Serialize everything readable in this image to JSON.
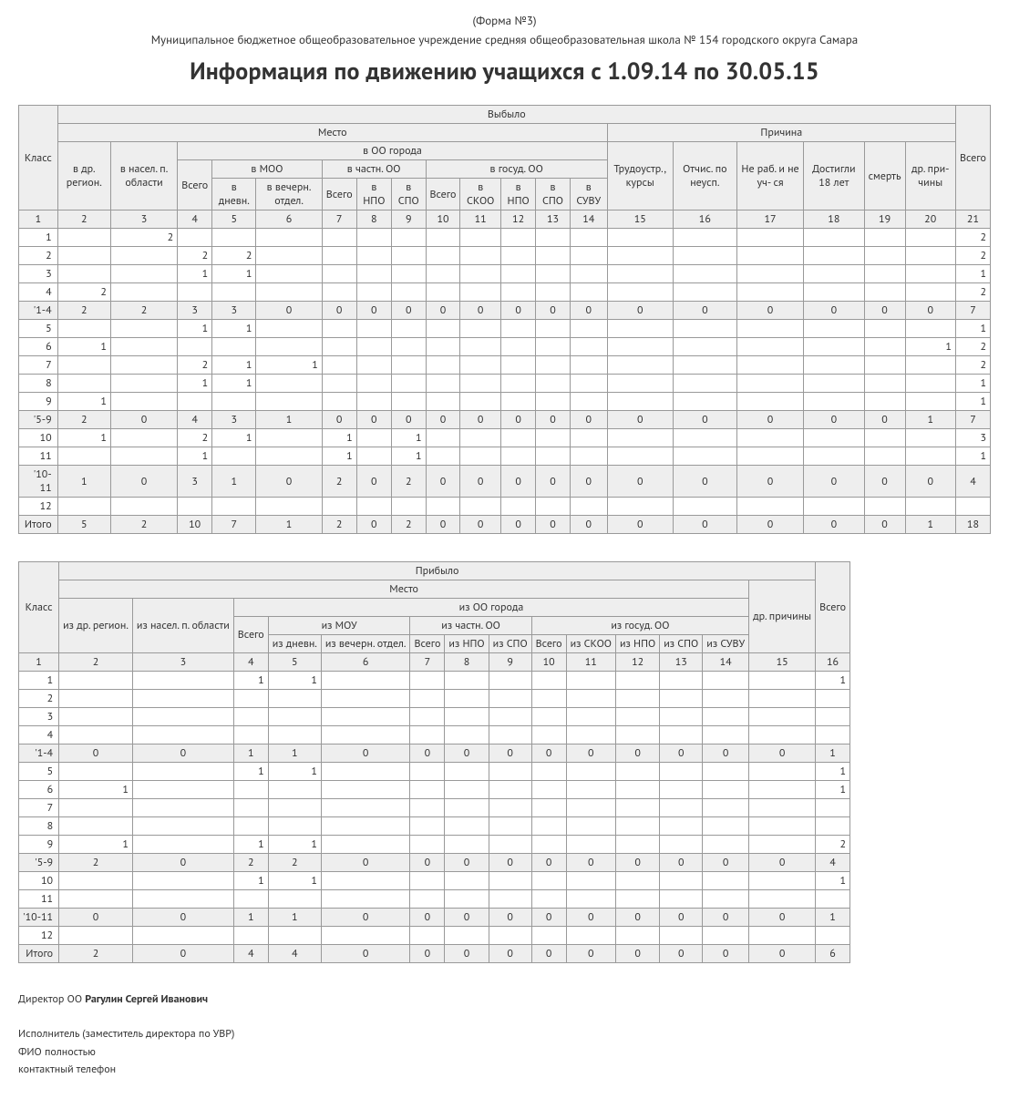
{
  "header": {
    "form_no": "(Форма №3)",
    "org": "Муниципальное бюджетное общеобразовательное учреждение средняя общеобразовательная школа № 154 городского округа Самара",
    "title": "Информация по движению учащихся с 1.09.14 по 30.05.15"
  },
  "table1": {
    "caption_top": "Выбыло",
    "caption_place": "Место",
    "caption_reason": "Причина",
    "caption_city": "в ОО города",
    "h": {
      "klass": "Класс",
      "region": "в др. реги­он.",
      "selo": "в на­сел. п. обл­асти",
      "vsego_moo": "Всего",
      "moo": "в МОО",
      "dnevn": "в дневн.",
      "vecher": "в вечерн. отдел.",
      "chast": "в частн. ОО",
      "vsego_ch": "Всего",
      "npo_ch": "в НПО",
      "spo_ch": "в СПО",
      "gos": "в госуд. ОО",
      "vsego_g": "Всего",
      "skoo": "в СКОО",
      "npo_g": "в НПО",
      "spo_g": "в СПО",
      "suvu": "в СУВУ",
      "trud": "Тру­до­устр., кур­сы",
      "otch": "От­чис. по неусп.",
      "nerab": "Не раб. и не уч- ся",
      "dost18": "Дос­тиг­ли 18 лет",
      "smert": "смерть",
      "dr": "др. при­чи­ны",
      "vsego": "Всего"
    },
    "colnums": [
      "1",
      "2",
      "3",
      "4",
      "5",
      "6",
      "7",
      "8",
      "9",
      "10",
      "11",
      "12",
      "13",
      "14",
      "15",
      "16",
      "17",
      "18",
      "19",
      "20",
      "21"
    ],
    "rows": [
      {
        "k": "1",
        "c": [
          "",
          "2",
          "",
          "",
          "",
          "",
          "",
          "",
          "",
          "",
          "",
          "",
          "",
          "",
          "",
          "",
          "",
          "",
          "",
          "2"
        ]
      },
      {
        "k": "2",
        "c": [
          "",
          "",
          "2",
          "2",
          "",
          "",
          "",
          "",
          "",
          "",
          "",
          "",
          "",
          "",
          "",
          "",
          "",
          "",
          "",
          "2"
        ]
      },
      {
        "k": "3",
        "c": [
          "",
          "",
          "1",
          "1",
          "",
          "",
          "",
          "",
          "",
          "",
          "",
          "",
          "",
          "",
          "",
          "",
          "",
          "",
          "",
          "1"
        ]
      },
      {
        "k": "4",
        "c": [
          "2",
          "",
          "",
          "",
          "",
          "",
          "",
          "",
          "",
          "",
          "",
          "",
          "",
          "",
          "",
          "",
          "",
          "",
          "",
          "2"
        ]
      },
      {
        "k": "'1-4",
        "sub": true,
        "c": [
          "2",
          "2",
          "3",
          "3",
          "0",
          "0",
          "0",
          "0",
          "0",
          "0",
          "0",
          "0",
          "0",
          "0",
          "0",
          "0",
          "0",
          "0",
          "0",
          "7"
        ]
      },
      {
        "k": "5",
        "c": [
          "",
          "",
          "1",
          "1",
          "",
          "",
          "",
          "",
          "",
          "",
          "",
          "",
          "",
          "",
          "",
          "",
          "",
          "",
          "",
          "1"
        ]
      },
      {
        "k": "6",
        "c": [
          "1",
          "",
          "",
          "",
          "",
          "",
          "",
          "",
          "",
          "",
          "",
          "",
          "",
          "",
          "",
          "",
          "",
          "",
          "1",
          "2"
        ]
      },
      {
        "k": "7",
        "c": [
          "",
          "",
          "2",
          "1",
          "1",
          "",
          "",
          "",
          "",
          "",
          "",
          "",
          "",
          "",
          "",
          "",
          "",
          "",
          "",
          "2"
        ]
      },
      {
        "k": "8",
        "c": [
          "",
          "",
          "1",
          "1",
          "",
          "",
          "",
          "",
          "",
          "",
          "",
          "",
          "",
          "",
          "",
          "",
          "",
          "",
          "",
          "1"
        ]
      },
      {
        "k": "9",
        "c": [
          "1",
          "",
          "",
          "",
          "",
          "",
          "",
          "",
          "",
          "",
          "",
          "",
          "",
          "",
          "",
          "",
          "",
          "",
          "",
          "1"
        ]
      },
      {
        "k": "'5-9",
        "sub": true,
        "c": [
          "2",
          "0",
          "4",
          "3",
          "1",
          "0",
          "0",
          "0",
          "0",
          "0",
          "0",
          "0",
          "0",
          "0",
          "0",
          "0",
          "0",
          "0",
          "1",
          "7"
        ]
      },
      {
        "k": "10",
        "c": [
          "1",
          "",
          "2",
          "1",
          "",
          "1",
          "",
          "1",
          "",
          "",
          "",
          "",
          "",
          "",
          "",
          "",
          "",
          "",
          "",
          "3"
        ]
      },
      {
        "k": "11",
        "c": [
          "",
          "",
          "1",
          "",
          "",
          "1",
          "",
          "1",
          "",
          "",
          "",
          "",
          "",
          "",
          "",
          "",
          "",
          "",
          "",
          "1"
        ]
      },
      {
        "k": "'10-11",
        "sub": true,
        "c": [
          "1",
          "0",
          "3",
          "1",
          "0",
          "2",
          "0",
          "2",
          "0",
          "0",
          "0",
          "0",
          "0",
          "0",
          "0",
          "0",
          "0",
          "0",
          "0",
          "4"
        ]
      },
      {
        "k": "12",
        "c": [
          "",
          "",
          "",
          "",
          "",
          "",
          "",
          "",
          "",
          "",
          "",
          "",
          "",
          "",
          "",
          "",
          "",
          "",
          "",
          ""
        ]
      },
      {
        "k": "Итого",
        "tot": true,
        "c": [
          "5",
          "2",
          "10",
          "7",
          "1",
          "2",
          "0",
          "2",
          "0",
          "0",
          "0",
          "0",
          "0",
          "0",
          "0",
          "0",
          "0",
          "0",
          "1",
          "18"
        ]
      }
    ]
  },
  "table2": {
    "caption_top": "Прибыло",
    "caption_place": "Место",
    "caption_city": "из ОО города",
    "h": {
      "klass": "Класс",
      "region": "из др. ре­ги­он.",
      "selo": "из на­сел. п. об­ласти",
      "vsego_moo": "Всего",
      "moo": "из МОУ",
      "dnevn": "из дневн.",
      "vecher": "из вечерн. отдел.",
      "chast": "из частн. ОО",
      "vsego_ch": "Всего",
      "npo_ch": "из НПО",
      "spo_ch": "из СПО",
      "gos": "из госуд. ОО",
      "vsego_g": "Всего",
      "skoo": "из СКОО",
      "npo_g": "из НПО",
      "spo_g": "из СПО",
      "suvu": "из СУВУ",
      "dr": "др. при­чи­ны",
      "vsego": "Всего"
    },
    "colnums": [
      "1",
      "2",
      "3",
      "4",
      "5",
      "6",
      "7",
      "8",
      "9",
      "10",
      "11",
      "12",
      "13",
      "14",
      "15",
      "16"
    ],
    "rows": [
      {
        "k": "1",
        "c": [
          "",
          "",
          "1",
          "1",
          "",
          "",
          "",
          "",
          "",
          "",
          "",
          "",
          "",
          "",
          "1"
        ]
      },
      {
        "k": "2",
        "c": [
          "",
          "",
          "",
          "",
          "",
          "",
          "",
          "",
          "",
          "",
          "",
          "",
          "",
          "",
          ""
        ]
      },
      {
        "k": "3",
        "c": [
          "",
          "",
          "",
          "",
          "",
          "",
          "",
          "",
          "",
          "",
          "",
          "",
          "",
          "",
          ""
        ]
      },
      {
        "k": "4",
        "c": [
          "",
          "",
          "",
          "",
          "",
          "",
          "",
          "",
          "",
          "",
          "",
          "",
          "",
          "",
          ""
        ]
      },
      {
        "k": "'1-4",
        "sub": true,
        "c": [
          "0",
          "0",
          "1",
          "1",
          "0",
          "0",
          "0",
          "0",
          "0",
          "0",
          "0",
          "0",
          "0",
          "0",
          "1"
        ]
      },
      {
        "k": "5",
        "c": [
          "",
          "",
          "1",
          "1",
          "",
          "",
          "",
          "",
          "",
          "",
          "",
          "",
          "",
          "",
          "1"
        ]
      },
      {
        "k": "6",
        "c": [
          "1",
          "",
          "",
          "",
          "",
          "",
          "",
          "",
          "",
          "",
          "",
          "",
          "",
          "",
          "1"
        ]
      },
      {
        "k": "7",
        "c": [
          "",
          "",
          "",
          "",
          "",
          "",
          "",
          "",
          "",
          "",
          "",
          "",
          "",
          "",
          ""
        ]
      },
      {
        "k": "8",
        "c": [
          "",
          "",
          "",
          "",
          "",
          "",
          "",
          "",
          "",
          "",
          "",
          "",
          "",
          "",
          ""
        ]
      },
      {
        "k": "9",
        "c": [
          "1",
          "",
          "1",
          "1",
          "",
          "",
          "",
          "",
          "",
          "",
          "",
          "",
          "",
          "",
          "2"
        ]
      },
      {
        "k": "'5-9",
        "sub": true,
        "c": [
          "2",
          "0",
          "2",
          "2",
          "0",
          "0",
          "0",
          "0",
          "0",
          "0",
          "0",
          "0",
          "0",
          "0",
          "4"
        ]
      },
      {
        "k": "10",
        "c": [
          "",
          "",
          "1",
          "1",
          "",
          "",
          "",
          "",
          "",
          "",
          "",
          "",
          "",
          "",
          "1"
        ]
      },
      {
        "k": "11",
        "c": [
          "",
          "",
          "",
          "",
          "",
          "",
          "",
          "",
          "",
          "",
          "",
          "",
          "",
          "",
          ""
        ]
      },
      {
        "k": "'10-11",
        "sub": true,
        "c": [
          "0",
          "0",
          "1",
          "1",
          "0",
          "0",
          "0",
          "0",
          "0",
          "0",
          "0",
          "0",
          "0",
          "0",
          "1"
        ]
      },
      {
        "k": "12",
        "c": [
          "",
          "",
          "",
          "",
          "",
          "",
          "",
          "",
          "",
          "",
          "",
          "",
          "",
          "",
          ""
        ]
      },
      {
        "k": "Итого",
        "tot": true,
        "c": [
          "2",
          "0",
          "4",
          "4",
          "0",
          "0",
          "0",
          "0",
          "0",
          "0",
          "0",
          "0",
          "0",
          "0",
          "6"
        ]
      }
    ]
  },
  "footer": {
    "l1a": "Директор ОО ",
    "l1b": "Рагулин Сергей Иванович",
    "l2": "Исполнитель (заместитель директора по УВР)",
    "l3": "ФИО полностью",
    "l4": "контактный телефон"
  }
}
